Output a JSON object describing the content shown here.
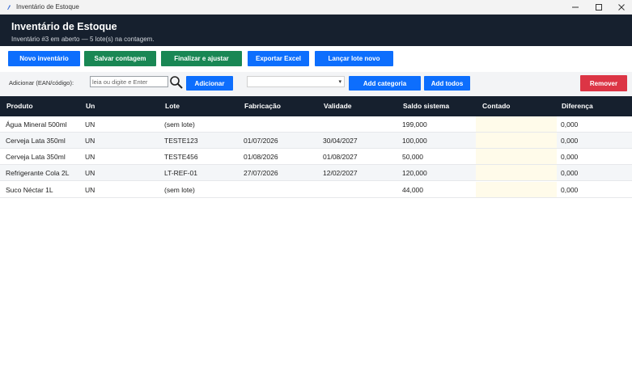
{
  "window": {
    "title": "Inventário de Estoque"
  },
  "header": {
    "title": "Inventário de Estoque",
    "subtitle": "Inventário #3 em aberto — 5 lote(s) na contagem."
  },
  "toolbar": {
    "novo_inventario": "Novo inventário",
    "salvar_contagem": "Salvar contagem",
    "finalizar_ajustar": "Finalizar e ajustar",
    "exportar_excel": "Exportar Excel",
    "lancar_lote_novo": "Lançar lote novo"
  },
  "add_bar": {
    "label": "Adicionar (EAN/código):",
    "placeholder": "leia ou digite e Enter",
    "adicionar": "Adicionar",
    "add_categoria": "Add categoria",
    "add_todos": "Add todos",
    "remover": "Remover",
    "category_value": ""
  },
  "table": {
    "columns": [
      "Produto",
      "Un",
      "Lote",
      "Fabricação",
      "Validade",
      "Saldo sistema",
      "Contado",
      "Diferença"
    ],
    "rows": [
      {
        "produto": "Água Mineral 500ml",
        "un": "UN",
        "lote": "(sem lote)",
        "fabricacao": "",
        "validade": "",
        "saldo": "199,000",
        "contado": "",
        "diferenca": "0,000"
      },
      {
        "produto": "Cerveja Lata 350ml",
        "un": "UN",
        "lote": "TESTE123",
        "fabricacao": "01/07/2026",
        "validade": "30/04/2027",
        "saldo": "100,000",
        "contado": "",
        "diferenca": "0,000"
      },
      {
        "produto": "Cerveja Lata 350ml",
        "un": "UN",
        "lote": "TESTE456",
        "fabricacao": "01/08/2026",
        "validade": "01/08/2027",
        "saldo": "50,000",
        "contado": "",
        "diferenca": "0,000"
      },
      {
        "produto": "Refrigerante Cola 2L",
        "un": "UN",
        "lote": "LT-REF-01",
        "fabricacao": "27/07/2026",
        "validade": "12/02/2027",
        "saldo": "120,000",
        "contado": "",
        "diferenca": "0,000"
      },
      {
        "produto": "Suco Néctar 1L",
        "un": "UN",
        "lote": "(sem lote)",
        "fabricacao": "",
        "validade": "",
        "saldo": "44,000",
        "contado": "",
        "diferenca": "0,000"
      }
    ]
  },
  "colors": {
    "header_bg": "#16202e",
    "primary": "#0d6efd",
    "success": "#198754",
    "danger": "#dc3545",
    "contado_bg": "#fffbea"
  }
}
